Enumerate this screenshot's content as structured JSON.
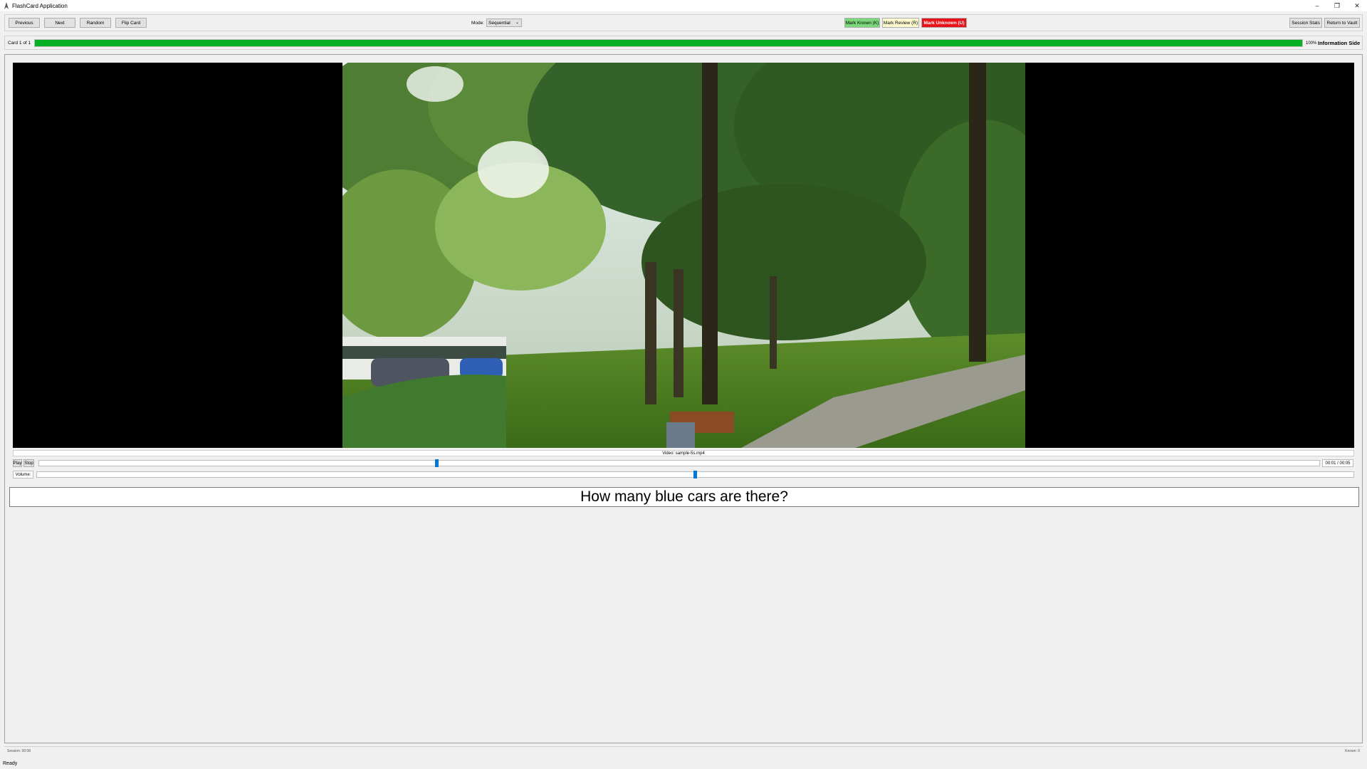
{
  "window": {
    "title": "FlashCard Application",
    "minimize_glyph": "–",
    "restore_glyph": "❐",
    "close_glyph": "✕"
  },
  "toolbar": {
    "previous_label": "Previous",
    "next_label": "Next",
    "random_label": "Random",
    "flip_label": "Flip Card",
    "mode_label": "Mode:",
    "mode_value": "Sequential",
    "mark_known_label": "Mark Known (K)",
    "mark_review_label": "Mark Review (R)",
    "mark_unknown_label": "Mark Unknown (U)",
    "session_stats_label": "Session Stats",
    "return_label": "Return to Vault"
  },
  "colors": {
    "known": "#7bd87b",
    "review": "#fffbd0",
    "unknown": "#e8121b",
    "progress": "#06b025",
    "slider_thumb": "#0078d7"
  },
  "progress": {
    "card_counter": "Card 1 of 1",
    "fraction": 1.0,
    "percent_label": "100%",
    "side_label": "Information Side"
  },
  "video": {
    "caption": "Video: sample-5s.mp4",
    "play_label": "Play",
    "stop_label": "Stop",
    "position_fraction": 0.31,
    "time_label": "00:01 / 00:05",
    "volume_label": "Volume:",
    "volume_fraction": 0.5
  },
  "card": {
    "question": "How many blue cars are there?"
  },
  "footer": {
    "left_text": "Session: 00:08",
    "right_text": "Known: 0"
  },
  "status": {
    "text": "Ready"
  }
}
